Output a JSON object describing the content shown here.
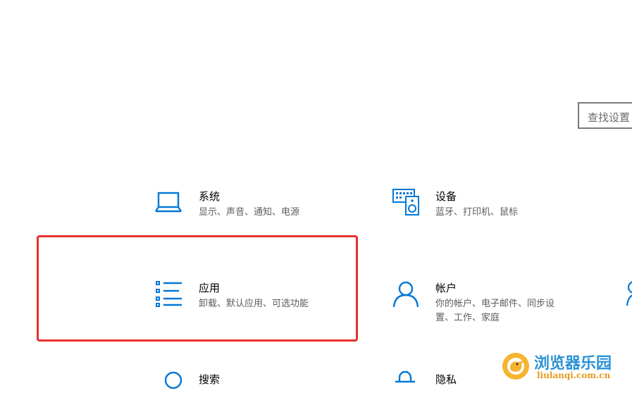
{
  "search": {
    "placeholder": "查找设置"
  },
  "tiles": {
    "system": {
      "title": "系统",
      "desc": "显示、声音、通知、电源"
    },
    "devices": {
      "title": "设备",
      "desc": "蓝牙、打印机、鼠标"
    },
    "apps": {
      "title": "应用",
      "desc": "卸载、默认应用、可选功能"
    },
    "accounts": {
      "title": "帐户",
      "desc_line1": "你的帐户、电子邮件、同步设",
      "desc_line2": "置、工作、家庭"
    },
    "search": {
      "title": "搜索"
    },
    "privacy": {
      "title": "隐私"
    }
  },
  "watermark": {
    "text": "浏览器乐园",
    "sub": "liulanqi.com.cn"
  },
  "colors": {
    "accent": "#0078d7",
    "highlight": "#e8302a"
  }
}
